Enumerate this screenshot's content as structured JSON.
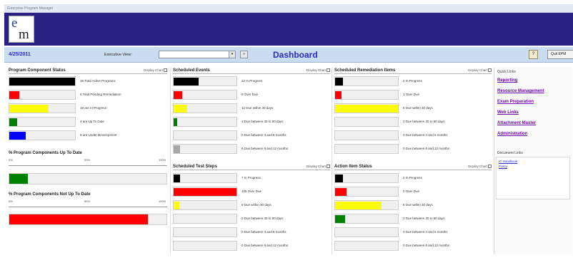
{
  "window": {
    "title": "Enterprise Program Manager"
  },
  "logo": {
    "line1": "e",
    "line2": "m"
  },
  "navbar": {
    "date": "4/25/2011",
    "executive_label": "Executive View:",
    "executive_value": "",
    "dropdown_arrow": "▾",
    "go_label": "»",
    "page_title": "Dashboard",
    "help_label": "?",
    "quit_label": "Quit EPM"
  },
  "display_chart_label": "Display Chart",
  "program_status": {
    "title": "Program Component Status",
    "rows": [
      {
        "label": "36 Total Active Programs",
        "fraction": 1.0,
        "color": "#000000"
      },
      {
        "label": "5 Total Pending Remediation",
        "fraction": 0.15,
        "color": "#ff0000"
      },
      {
        "label": "18 are In Progress",
        "fraction": 0.6,
        "color": "#ffff00"
      },
      {
        "label": "4 are Up To Date",
        "fraction": 0.12,
        "color": "#008000"
      },
      {
        "label": "8 are Under Development",
        "fraction": 0.25,
        "color": "#0000ff"
      }
    ]
  },
  "up_to_date": {
    "title": "% Program Components Up To Date",
    "scale": [
      "0%",
      "50%",
      "100%"
    ],
    "percent": 12,
    "color": "#008000"
  },
  "not_up_to_date": {
    "title": "% Program Components Not Up To Date",
    "scale": [
      "0%",
      "50%",
      "100%"
    ],
    "percent": 88,
    "color": "#ff0000"
  },
  "scheduled_events": {
    "title": "Scheduled Events",
    "rows": [
      {
        "label": "22 In Progress",
        "fraction": 0.4,
        "color": "#000000"
      },
      {
        "label": "8 Over Due",
        "fraction": 0.14,
        "color": "#ff0000"
      },
      {
        "label": "12 Due within 30 days",
        "fraction": 0.22,
        "color": "#ffff00"
      },
      {
        "label": "4 Due between 30 to 90 days",
        "fraction": 0.06,
        "color": "#008000"
      },
      {
        "label": "0 Due between 3 and 6 months",
        "fraction": 0,
        "color": "#a8a8a8"
      },
      {
        "label": "6 Due between 6 and 12 months",
        "fraction": 0.1,
        "color": "#a8a8a8"
      }
    ]
  },
  "scheduled_test_steps": {
    "title": "Scheduled Test Steps",
    "rows": [
      {
        "label": "7 In Progress",
        "fraction": 0.1,
        "color": "#000000"
      },
      {
        "label": "105 Over Due",
        "fraction": 1.0,
        "color": "#ff0000"
      },
      {
        "label": "6 Due within 30 days",
        "fraction": 0.09,
        "color": "#ffff00"
      },
      {
        "label": "0 Due between 30 to 90 days",
        "fraction": 0,
        "color": "#008000"
      },
      {
        "label": "0 Due between 3 and 6 months",
        "fraction": 0,
        "color": "#a8a8a8"
      },
      {
        "label": "0 Due between 6 and 12 months",
        "fraction": 0,
        "color": "#a8a8a8"
      }
    ]
  },
  "scheduled_remediation": {
    "title": "Scheduled Remediation Items",
    "rows": [
      {
        "label": "2 In Progress",
        "fraction": 0.12,
        "color": "#000000"
      },
      {
        "label": "1 Over Due",
        "fraction": 0.1,
        "color": "#ff0000"
      },
      {
        "label": "8 Due within 30 days",
        "fraction": 1.0,
        "color": "#ffff00"
      },
      {
        "label": "0 Due between 30 to 90 days",
        "fraction": 0,
        "color": "#008000"
      },
      {
        "label": "0 Due between 3 and 6 months",
        "fraction": 0,
        "color": "#a8a8a8"
      },
      {
        "label": "0 Due between 6 and 12 months",
        "fraction": 0,
        "color": "#a8a8a8"
      }
    ]
  },
  "action_items": {
    "title": "Action Item Status",
    "rows": [
      {
        "label": "2 In Progress",
        "fraction": 0.12,
        "color": "#000000"
      },
      {
        "label": "2 Over Due",
        "fraction": 0.18,
        "color": "#ff0000"
      },
      {
        "label": "8 Due within 30 days",
        "fraction": 0.74,
        "color": "#ffff00"
      },
      {
        "label": "2 Due between 30 to 90 days",
        "fraction": 0.16,
        "color": "#008000"
      },
      {
        "label": "0 Due between 3 and 6 months",
        "fraction": 0,
        "color": "#a8a8a8"
      },
      {
        "label": "0 Due between 6 and 12 months",
        "fraction": 0,
        "color": "#a8a8a8"
      }
    ]
  },
  "quick_links": {
    "title": "Quick Links",
    "items": [
      "Reporting",
      "Resource Management",
      "Exam Preparation",
      "Web Links",
      "Attachment Master",
      "Administration"
    ]
  },
  "document_links": {
    "title": "Document Links",
    "items": [
      "IC Handbook",
      "Policy"
    ]
  }
}
